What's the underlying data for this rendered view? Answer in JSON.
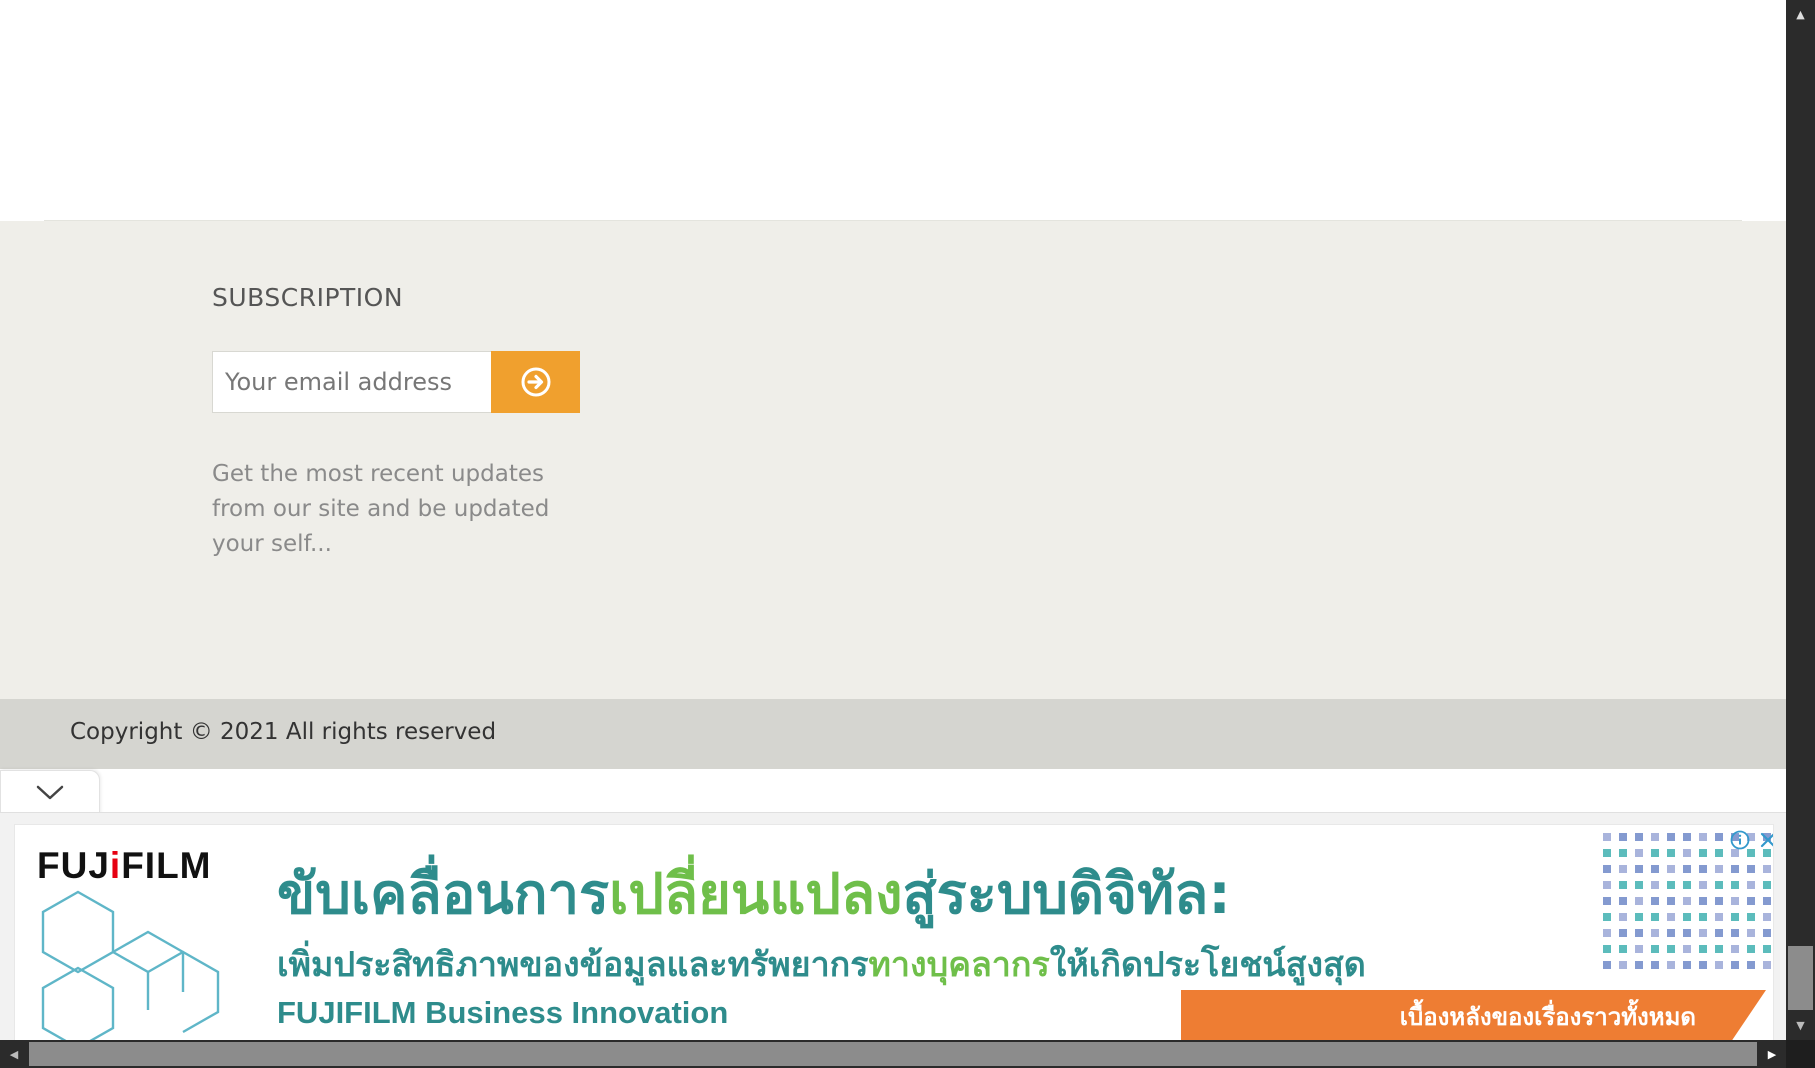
{
  "subscription": {
    "title": "SUBSCRIPTION",
    "email_placeholder": "Your email address",
    "description": "Get the most recent updates from our site and be updated your self...",
    "submit_icon": "arrow-circle-right-icon",
    "accent_color": "#f0a02e"
  },
  "footer": {
    "copyright": "Copyright © 2021 All rights reserved",
    "background_color": "#efeee9",
    "copyright_bar_color": "#d5d5d0"
  },
  "ad": {
    "toggle_icon": "chevron-down-icon",
    "brand_before_i": "FUJ",
    "brand_i": "i",
    "brand_after_i": "FILM",
    "headline_part1": "ขับเคลื่อนการ",
    "headline_accent": "เปลี่ยนแปลง",
    "headline_part2": "สู่ระบบดิจิทัล:",
    "subline_part1": "เพิ่มประสิทธิภาพของข้อมูลและทรัพยากร",
    "subline_accent": "ทางบุคลากร",
    "subline_part2": "ให้เกิดประโยชน์สูงสุด",
    "company": "FUJIFILM Business Innovation",
    "cta": "เบื้องหลังของเรื่องราวทั้งหมด",
    "info_icon": "info-icon",
    "close_icon": "close-icon",
    "text_color": "#2e8c8c",
    "accent_color": "#6fbf4a",
    "cta_color": "#ee7d33"
  },
  "scrollbars": {
    "up_icon": "arrow-up-icon",
    "down_icon": "arrow-down-icon",
    "left_icon": "arrow-left-icon",
    "right_icon": "arrow-right-icon"
  }
}
